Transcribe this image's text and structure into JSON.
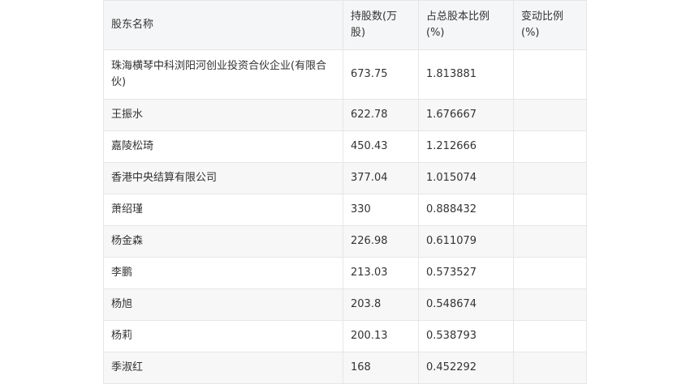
{
  "table": {
    "headers": [
      "股东名称",
      "持股数(万股)",
      "占总股本比例(%)",
      "变动比例(%)"
    ],
    "rows": [
      {
        "name": "珠海横琴中科浏阳河创业投资合伙企业(有限合伙)",
        "shares": "673.75",
        "ratio": "1.813881",
        "change": ""
      },
      {
        "name": "王振水",
        "shares": "622.78",
        "ratio": "1.676667",
        "change": ""
      },
      {
        "name": "嘉陵松琦",
        "shares": "450.43",
        "ratio": "1.212666",
        "change": ""
      },
      {
        "name": "香港中央结算有限公司",
        "shares": "377.04",
        "ratio": "1.015074",
        "change": ""
      },
      {
        "name": "萧绍瑾",
        "shares": "330",
        "ratio": "0.888432",
        "change": ""
      },
      {
        "name": "杨金森",
        "shares": "226.98",
        "ratio": "0.611079",
        "change": ""
      },
      {
        "name": "李鹏",
        "shares": "213.03",
        "ratio": "0.573527",
        "change": ""
      },
      {
        "name": "杨旭",
        "shares": "203.8",
        "ratio": "0.548674",
        "change": ""
      },
      {
        "name": "杨莉",
        "shares": "200.13",
        "ratio": "0.538793",
        "change": ""
      },
      {
        "name": "季淑红",
        "shares": "168",
        "ratio": "0.452292",
        "change": ""
      }
    ]
  }
}
